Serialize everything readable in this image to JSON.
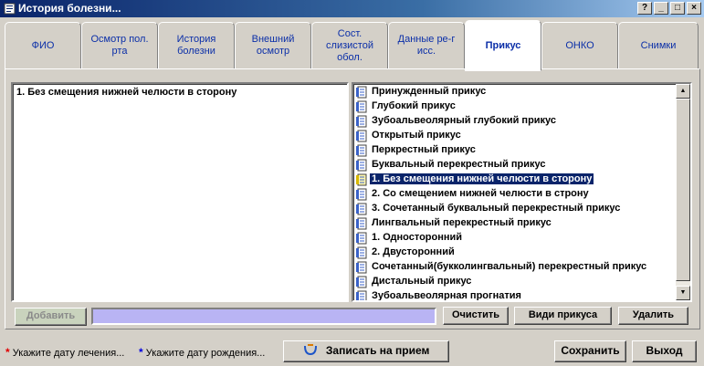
{
  "window": {
    "title": "История болезни..."
  },
  "title_buttons": [
    "?",
    "_",
    "□",
    "×"
  ],
  "tabs": [
    {
      "label": "ФИО"
    },
    {
      "label": "Осмотр пол. рта"
    },
    {
      "label": "История болезни"
    },
    {
      "label": "Внешний осмотр"
    },
    {
      "label": "Сост. слизистой обол."
    },
    {
      "label": "Данные ре-г исс."
    },
    {
      "label": "Прикус",
      "active": true
    },
    {
      "label": "ОНКО"
    },
    {
      "label": "Снимки"
    }
  ],
  "left_list": {
    "items": [
      "1.  Без смещения нижней челюсти в сторону"
    ]
  },
  "right_list": {
    "items": [
      {
        "text": "Принужденный прикус",
        "icon": "document-icon"
      },
      {
        "text": "Глубокий прикус",
        "icon": "document-icon"
      },
      {
        "text": "Зубоальвеолярный глубокий прикус",
        "icon": "document-icon"
      },
      {
        "text": "Открытый прикус",
        "icon": "document-icon"
      },
      {
        "text": "Перкрестный прикус",
        "icon": "document-icon"
      },
      {
        "text": "Буквальный перекрестный прикус",
        "icon": "document-icon"
      },
      {
        "text": "1.   Без смещения нижней челюсти в сторону",
        "icon": "document-yellow-icon",
        "selected": true
      },
      {
        "text": "2.   Со смещением нижней челюсти в строну",
        "icon": "document-icon"
      },
      {
        "text": "3.   Сочетанный буквальный перекрестный прикус",
        "icon": "document-icon"
      },
      {
        "text": "Лингвальный перекрестный прикус",
        "icon": "document-icon"
      },
      {
        "text": "1.   Односторонний",
        "icon": "document-icon"
      },
      {
        "text": "2.   Двусторонний",
        "icon": "document-icon"
      },
      {
        "text": "Сочетанный(букколингвальный) перекрестный прикус",
        "icon": "document-icon"
      },
      {
        "text": "Дистальный прикус",
        "icon": "document-icon"
      },
      {
        "text": "Зубоальвеолярная прогнатия",
        "icon": "document-icon"
      }
    ]
  },
  "buttons": {
    "add": "Добавить",
    "clear": "Очистить",
    "bite_types": "Види прикуса",
    "delete": "Удалить",
    "appointment": "Записать на прием",
    "save": "Сохранить",
    "exit": "Выход"
  },
  "notes": {
    "treatment_date": "Укажите дату лечения...",
    "birth_date": "Укажите дату рождения..."
  },
  "colors": {
    "title_gradient_start": "#0a246a",
    "tab_text": "#0b2fa8",
    "selection": "#0a246a",
    "input_fill": "#b9b4f4",
    "star_red": "#e00000",
    "star_blue": "#0000e0"
  }
}
